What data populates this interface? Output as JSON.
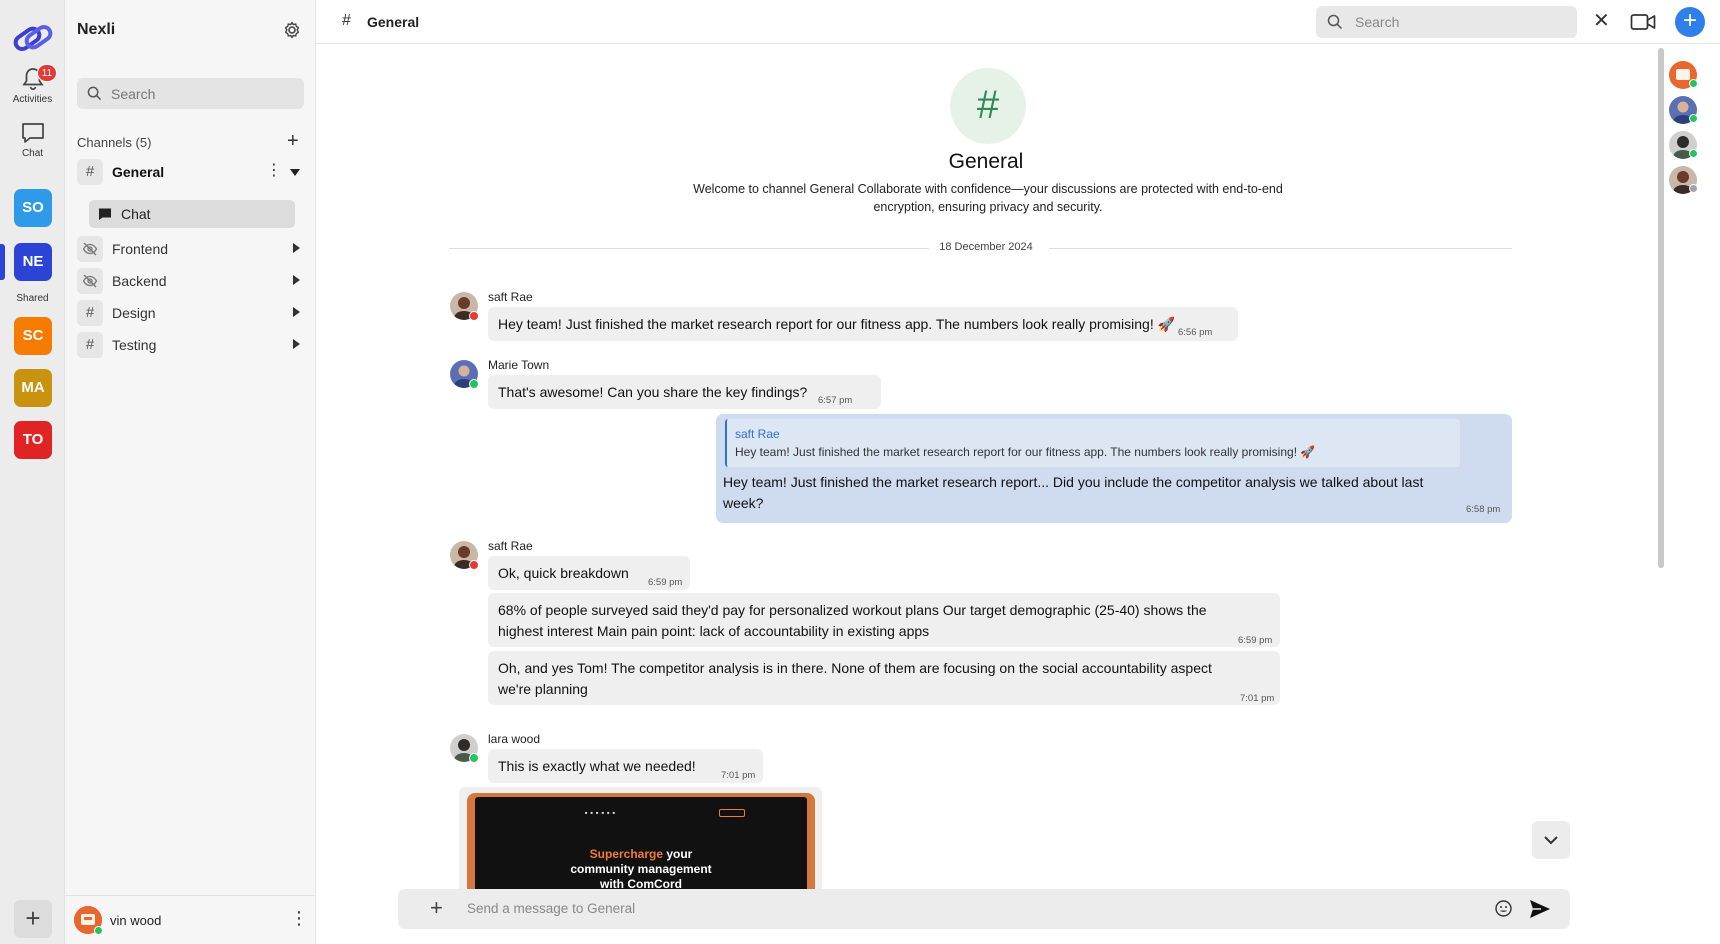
{
  "app": {
    "name": "Nexli"
  },
  "rail": {
    "activities_label": "Activities",
    "activities_badge": "11",
    "chat_label": "Chat",
    "shared_label": "Shared",
    "workspaces": [
      {
        "initials": "SO",
        "color": "#2f9be8"
      },
      {
        "initials": "NE",
        "color": "#2b44d6",
        "active": true
      },
      {
        "initials": "SC",
        "color": "#f57c00"
      },
      {
        "initials": "MA",
        "color": "#c9920f"
      },
      {
        "initials": "TO",
        "color": "#e02424"
      }
    ],
    "add_icon": "plus-icon"
  },
  "sidebar": {
    "title": "Nexli",
    "search_placeholder": "Search",
    "channels_heading": "Channels (5)",
    "channels": [
      {
        "name": "General",
        "icon": "hash-icon",
        "expanded": true
      },
      {
        "name": "Frontend",
        "icon": "eye-off-icon"
      },
      {
        "name": "Backend",
        "icon": "eye-off-icon"
      },
      {
        "name": "Design",
        "icon": "hash-icon"
      },
      {
        "name": "Testing",
        "icon": "hash-icon"
      }
    ],
    "subchannel": {
      "name": "Chat",
      "icon": "chat-bubble-icon"
    },
    "user": {
      "name": "vin wood",
      "status": "online"
    }
  },
  "header": {
    "channel_icon": "#",
    "channel_name": "General",
    "search_placeholder": "Search",
    "close_icon": "close-icon",
    "video_icon": "video-camera-icon",
    "add_icon": "plus-icon"
  },
  "channel_intro": {
    "icon": "#",
    "title": "General",
    "description": "Welcome to channel General Collaborate with confidence—your discussions are protected with end-to-end encryption, ensuring privacy and security."
  },
  "date_divider": "18 December 2024",
  "messages": [
    {
      "sender": "saft Rae",
      "status": "busy",
      "text": "Hey team! Just finished the market research report for our fitness app. The numbers look really promising! 🚀",
      "time": "6:56 pm"
    },
    {
      "sender": "Marie Town",
      "status": "online",
      "text": "That's awesome! Can you share the key findings?",
      "time": "6:57 pm"
    },
    {
      "reply_to": {
        "sender": "saft Rae",
        "text": "Hey team! Just finished the market research report for our fitness app. The numbers look really promising! 🚀"
      },
      "text": "Hey team! Just finished the market research report... Did you include the competitor analysis we talked about last week?",
      "time": "6:58 pm",
      "own": true
    },
    {
      "sender": "saft Rae",
      "status": "busy",
      "text": "Ok, quick breakdown",
      "time": "6:59 pm"
    },
    {
      "text": "68% of people surveyed said they'd pay for personalized workout plans Our target demographic (25-40) shows the highest interest Main pain point: lack of accountability in existing apps",
      "time": "6:59 pm"
    },
    {
      "text": "Oh, and yes Tom! The competitor analysis is in there. None of them are focusing on the social accountability aspect we're planning",
      "time": "7:01 pm"
    },
    {
      "sender": "lara wood",
      "status": "online",
      "text": "This is exactly what we needed!",
      "time": "7:01 pm"
    }
  ],
  "image_preview": {
    "headline_accent": "Supercharge",
    "headline_rest": "your",
    "headline_line2": "community management",
    "headline_line3": "with ComCord"
  },
  "composer": {
    "placeholder": "Send a message to General",
    "add_icon": "plus-icon",
    "emoji_icon": "emoji-icon",
    "send_icon": "send-icon"
  },
  "members": [
    {
      "color": "#e8672f",
      "status": "online"
    },
    {
      "color": "#5b6fb5",
      "status": "online"
    },
    {
      "color": "#3a4a3a",
      "status": "online"
    },
    {
      "color": "#7a3b2e",
      "status": "offline"
    }
  ],
  "colors": {
    "accent": "#2f7fe8",
    "online": "#22c55e",
    "busy": "#e53935",
    "offline": "#9ca3af"
  }
}
